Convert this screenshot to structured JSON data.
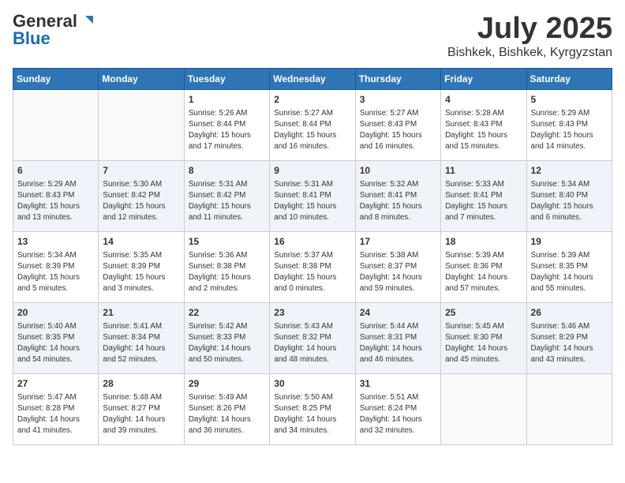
{
  "header": {
    "logo_general": "General",
    "logo_blue": "Blue",
    "title": "July 2025",
    "location": "Bishkek, Bishkek, Kyrgyzstan"
  },
  "weekdays": [
    "Sunday",
    "Monday",
    "Tuesday",
    "Wednesday",
    "Thursday",
    "Friday",
    "Saturday"
  ],
  "weeks": [
    [
      {
        "day": "",
        "info": ""
      },
      {
        "day": "",
        "info": ""
      },
      {
        "day": "1",
        "info": "Sunrise: 5:26 AM\nSunset: 8:44 PM\nDaylight: 15 hours\nand 17 minutes."
      },
      {
        "day": "2",
        "info": "Sunrise: 5:27 AM\nSunset: 8:44 PM\nDaylight: 15 hours\nand 16 minutes."
      },
      {
        "day": "3",
        "info": "Sunrise: 5:27 AM\nSunset: 8:43 PM\nDaylight: 15 hours\nand 16 minutes."
      },
      {
        "day": "4",
        "info": "Sunrise: 5:28 AM\nSunset: 8:43 PM\nDaylight: 15 hours\nand 15 minutes."
      },
      {
        "day": "5",
        "info": "Sunrise: 5:29 AM\nSunset: 8:43 PM\nDaylight: 15 hours\nand 14 minutes."
      }
    ],
    [
      {
        "day": "6",
        "info": "Sunrise: 5:29 AM\nSunset: 8:43 PM\nDaylight: 15 hours\nand 13 minutes."
      },
      {
        "day": "7",
        "info": "Sunrise: 5:30 AM\nSunset: 8:42 PM\nDaylight: 15 hours\nand 12 minutes."
      },
      {
        "day": "8",
        "info": "Sunrise: 5:31 AM\nSunset: 8:42 PM\nDaylight: 15 hours\nand 11 minutes."
      },
      {
        "day": "9",
        "info": "Sunrise: 5:31 AM\nSunset: 8:41 PM\nDaylight: 15 hours\nand 10 minutes."
      },
      {
        "day": "10",
        "info": "Sunrise: 5:32 AM\nSunset: 8:41 PM\nDaylight: 15 hours\nand 8 minutes."
      },
      {
        "day": "11",
        "info": "Sunrise: 5:33 AM\nSunset: 8:41 PM\nDaylight: 15 hours\nand 7 minutes."
      },
      {
        "day": "12",
        "info": "Sunrise: 5:34 AM\nSunset: 8:40 PM\nDaylight: 15 hours\nand 6 minutes."
      }
    ],
    [
      {
        "day": "13",
        "info": "Sunrise: 5:34 AM\nSunset: 8:39 PM\nDaylight: 15 hours\nand 5 minutes."
      },
      {
        "day": "14",
        "info": "Sunrise: 5:35 AM\nSunset: 8:39 PM\nDaylight: 15 hours\nand 3 minutes."
      },
      {
        "day": "15",
        "info": "Sunrise: 5:36 AM\nSunset: 8:38 PM\nDaylight: 15 hours\nand 2 minutes."
      },
      {
        "day": "16",
        "info": "Sunrise: 5:37 AM\nSunset: 8:38 PM\nDaylight: 15 hours\nand 0 minutes."
      },
      {
        "day": "17",
        "info": "Sunrise: 5:38 AM\nSunset: 8:37 PM\nDaylight: 14 hours\nand 59 minutes."
      },
      {
        "day": "18",
        "info": "Sunrise: 5:39 AM\nSunset: 8:36 PM\nDaylight: 14 hours\nand 57 minutes."
      },
      {
        "day": "19",
        "info": "Sunrise: 5:39 AM\nSunset: 8:35 PM\nDaylight: 14 hours\nand 55 minutes."
      }
    ],
    [
      {
        "day": "20",
        "info": "Sunrise: 5:40 AM\nSunset: 8:35 PM\nDaylight: 14 hours\nand 54 minutes."
      },
      {
        "day": "21",
        "info": "Sunrise: 5:41 AM\nSunset: 8:34 PM\nDaylight: 14 hours\nand 52 minutes."
      },
      {
        "day": "22",
        "info": "Sunrise: 5:42 AM\nSunset: 8:33 PM\nDaylight: 14 hours\nand 50 minutes."
      },
      {
        "day": "23",
        "info": "Sunrise: 5:43 AM\nSunset: 8:32 PM\nDaylight: 14 hours\nand 48 minutes."
      },
      {
        "day": "24",
        "info": "Sunrise: 5:44 AM\nSunset: 8:31 PM\nDaylight: 14 hours\nand 46 minutes."
      },
      {
        "day": "25",
        "info": "Sunrise: 5:45 AM\nSunset: 8:30 PM\nDaylight: 14 hours\nand 45 minutes."
      },
      {
        "day": "26",
        "info": "Sunrise: 5:46 AM\nSunset: 8:29 PM\nDaylight: 14 hours\nand 43 minutes."
      }
    ],
    [
      {
        "day": "27",
        "info": "Sunrise: 5:47 AM\nSunset: 8:28 PM\nDaylight: 14 hours\nand 41 minutes."
      },
      {
        "day": "28",
        "info": "Sunrise: 5:48 AM\nSunset: 8:27 PM\nDaylight: 14 hours\nand 39 minutes."
      },
      {
        "day": "29",
        "info": "Sunrise: 5:49 AM\nSunset: 8:26 PM\nDaylight: 14 hours\nand 36 minutes."
      },
      {
        "day": "30",
        "info": "Sunrise: 5:50 AM\nSunset: 8:25 PM\nDaylight: 14 hours\nand 34 minutes."
      },
      {
        "day": "31",
        "info": "Sunrise: 5:51 AM\nSunset: 8:24 PM\nDaylight: 14 hours\nand 32 minutes."
      },
      {
        "day": "",
        "info": ""
      },
      {
        "day": "",
        "info": ""
      }
    ]
  ]
}
